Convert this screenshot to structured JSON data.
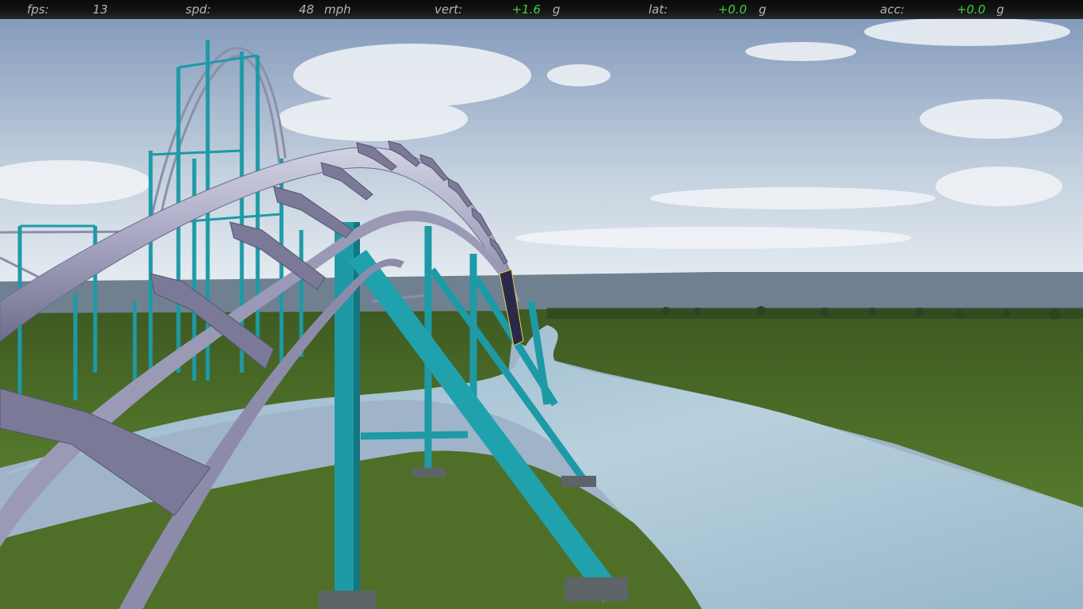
{
  "hud": {
    "fps": {
      "label": "fps:",
      "value": "13",
      "unit": ""
    },
    "spd": {
      "label": "spd:",
      "value": "48",
      "unit": "mph"
    },
    "vert": {
      "label": "vert:",
      "value": "+1.6",
      "unit": "g"
    },
    "lat": {
      "label": "lat:",
      "value": "+0.0",
      "unit": "g"
    },
    "acc": {
      "label": "acc:",
      "value": "+0.0",
      "unit": "g"
    }
  },
  "colors": {
    "hud_text": "#b4b4b4",
    "hud_value_good": "#3fd03a",
    "track_rail": "#9c9cb8",
    "support": "#1d9aa6",
    "grass": "#4a6a26",
    "water": "#a9c6d6",
    "sky_top": "#7f97b9",
    "sky_bottom": "#dfe7ef"
  }
}
